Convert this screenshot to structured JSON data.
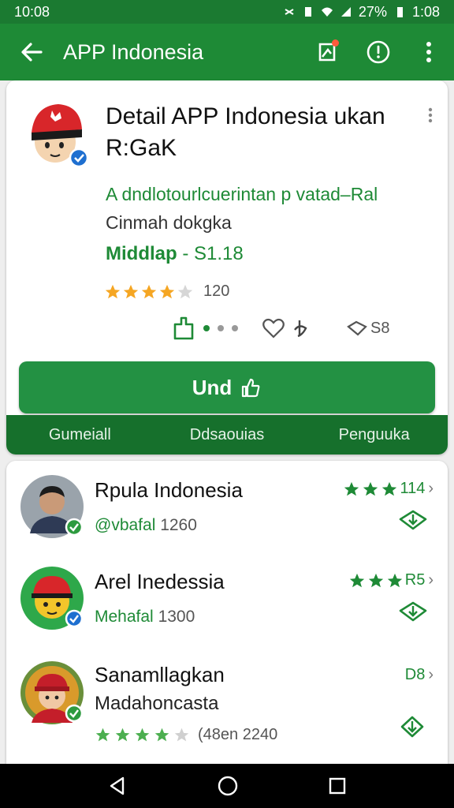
{
  "status_bar": {
    "time_left": "10:08",
    "battery": "27%",
    "time_right": "1:08"
  },
  "app_bar": {
    "title": "APP Indonesia"
  },
  "detail": {
    "title": "Detail APP Indonesia ukan R:GaK",
    "description_line1": "A dndlotourlcuerintan p vatad–Ral",
    "description_line2": "Cinmah dokgka",
    "price_label": "Middlap",
    "price_value": "- S1.18",
    "rating_stars": 4,
    "rating_count": "120",
    "reply_count": "S8",
    "primary_button": "Und",
    "tabs": [
      "Gumeiall",
      "Ddsaouias",
      "Penguuka"
    ]
  },
  "list": [
    {
      "name": "Rpula Indonesia",
      "sub_label": "@vbafal",
      "sub_num": "1260",
      "right_stars": 3,
      "right_text": "114"
    },
    {
      "name": "Arel Inedessia",
      "sub_label": "Mehafal",
      "sub_num": "1300",
      "right_stars": 3,
      "right_text": "R5"
    },
    {
      "name": "Sanamllagkan",
      "sub_label": "Madahoncasta",
      "right_text": "D8",
      "stars": 4,
      "meta": "(48en 2240"
    }
  ],
  "colors": {
    "primary": "#1e8a36",
    "status_bar": "#1b7a31",
    "tab_bar": "#16702c",
    "star": "#f5a623"
  },
  "icons": [
    "back-arrow-icon",
    "notification-icon",
    "info-icon",
    "more-vert-icon",
    "thumb-icon",
    "heart-icon",
    "reply-icon",
    "download-icon",
    "home-icon",
    "recents-icon"
  ]
}
